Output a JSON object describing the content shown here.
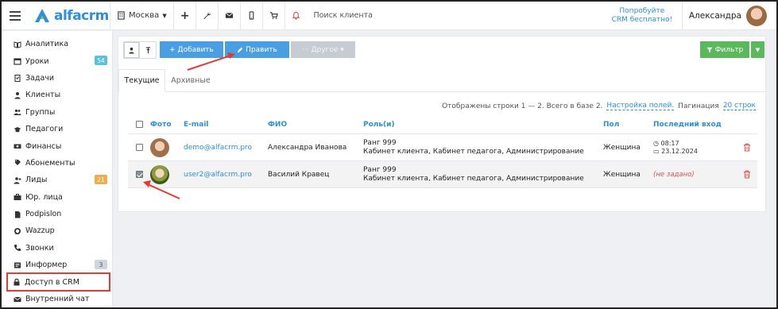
{
  "topbar": {
    "logo": "alfacrm",
    "city": "Москва",
    "search_placeholder": "Поиск клиента",
    "trial_line1": "Попробуйте",
    "trial_line2": "CRM бесплатно!",
    "user_name": "Александра"
  },
  "sidebar": {
    "items": [
      {
        "label": "Аналитика",
        "icon": "analytics-icon"
      },
      {
        "label": "Уроки",
        "icon": "calendar-icon",
        "badge": "54"
      },
      {
        "label": "Задачи",
        "icon": "tasks-icon"
      },
      {
        "label": "Клиенты",
        "icon": "user-icon"
      },
      {
        "label": "Группы",
        "icon": "group-icon"
      },
      {
        "label": "Педагоги",
        "icon": "teacher-icon"
      },
      {
        "label": "Финансы",
        "icon": "money-icon"
      },
      {
        "label": "Абонементы",
        "icon": "subscription-icon"
      },
      {
        "label": "Лиды",
        "icon": "user-plus-icon",
        "badge": "21"
      },
      {
        "label": "Юр. лица",
        "icon": "briefcase-icon"
      },
      {
        "label": "Podpislon",
        "icon": "file-icon"
      },
      {
        "label": "Wazzup",
        "icon": "whatsapp-icon"
      },
      {
        "label": "Звонки",
        "icon": "phone-icon"
      },
      {
        "label": "Информер",
        "icon": "newspaper-icon",
        "badge": "3"
      },
      {
        "label": "Доступ в CRM",
        "icon": "lock-icon"
      },
      {
        "label": "Внутренний чат",
        "icon": "envelope-icon"
      }
    ]
  },
  "toolbar": {
    "add_label": "+ Добавить",
    "edit_label": "Править",
    "other_label": "··· Другое ▾",
    "filter_label": "Фильтр"
  },
  "tabs": {
    "current": "Текущие",
    "archive": "Архивные"
  },
  "meta": {
    "shown": "Отображены строки 1 — 2. Всего в базе 2.",
    "settings_link": "Настройка полей.",
    "pagination_label": "Пагинация",
    "pagination_value": "20 строк"
  },
  "table": {
    "headers": {
      "photo": "Фото",
      "email": "E-mail",
      "fio": "ФИО",
      "role": "Роль(и)",
      "sex": "Пол",
      "last_login": "Последний вход"
    },
    "rows": [
      {
        "email": "demo@alfacrm.pro",
        "fio": "Александра Иванова",
        "role_line1": "Ранг 999",
        "role_line2": "Кабинет клиента, Кабинет педагога, Администрирование",
        "sex": "Женщина",
        "last_time": "08:17",
        "last_date": "23.12.2024",
        "checked": false
      },
      {
        "email": "user2@alfacrm.pro",
        "fio": "Василий Кравец",
        "role_line1": "Ранг 999",
        "role_line2": "Кабинет клиента, Кабинет педагога, Администрирование",
        "sex": "Женщина",
        "last_empty": "(не задано)",
        "checked": true
      }
    ]
  },
  "colors": {
    "primary": "#4a9fe3",
    "success": "#5cb85c",
    "danger": "#d9534f",
    "annotation": "#e53935"
  }
}
